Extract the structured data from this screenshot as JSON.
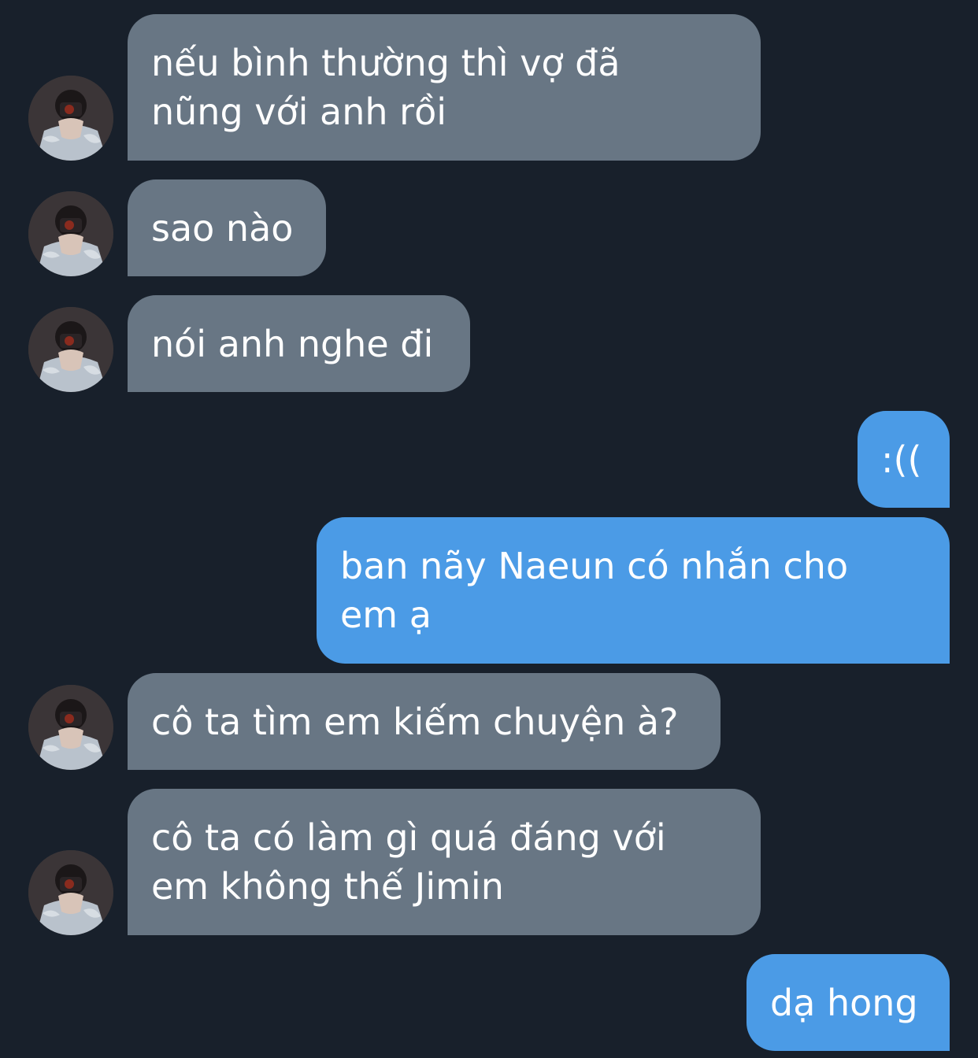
{
  "conversation": {
    "messages": [
      {
        "sender": "other",
        "text": "nếu bình thường thì vợ đã\nnũng với anh rồi"
      },
      {
        "sender": "other",
        "text": "sao nào"
      },
      {
        "sender": "other",
        "text": "nói anh nghe đi"
      },
      {
        "sender": "me",
        "text": ":(("
      },
      {
        "sender": "me",
        "text": "ban nãy Naeun có nhắn cho\nem ạ"
      },
      {
        "sender": "other",
        "text": "cô ta tìm em kiếm chuyện à?"
      },
      {
        "sender": "other",
        "text": "cô ta có làm gì quá đáng với\nem không thế Jimin"
      },
      {
        "sender": "me",
        "text": "dạ hong"
      }
    ]
  },
  "colors": {
    "background": "#18202b",
    "incoming_bubble": "#687684",
    "outgoing_bubble": "#4b9be6",
    "text": "#ffffff"
  }
}
